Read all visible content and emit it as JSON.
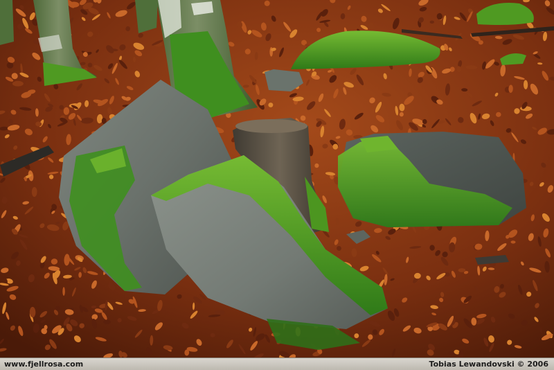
{
  "photo": {
    "subject": "forest floor scene",
    "colors": {
      "leaves_dark": "#5a200c",
      "leaves_mid": "#8a3a14",
      "leaves_light": "#c9692a",
      "moss": "#3f8f1f",
      "moss_light": "#6fb52e",
      "rock": "#5f6760",
      "rock_light": "#8a918a",
      "bark": "#6d7a5e",
      "stump": "#5a4e40"
    }
  },
  "caption": {
    "website": "www.fjellrosa.com",
    "credit": "Tobias Lewandovski © 2006"
  }
}
